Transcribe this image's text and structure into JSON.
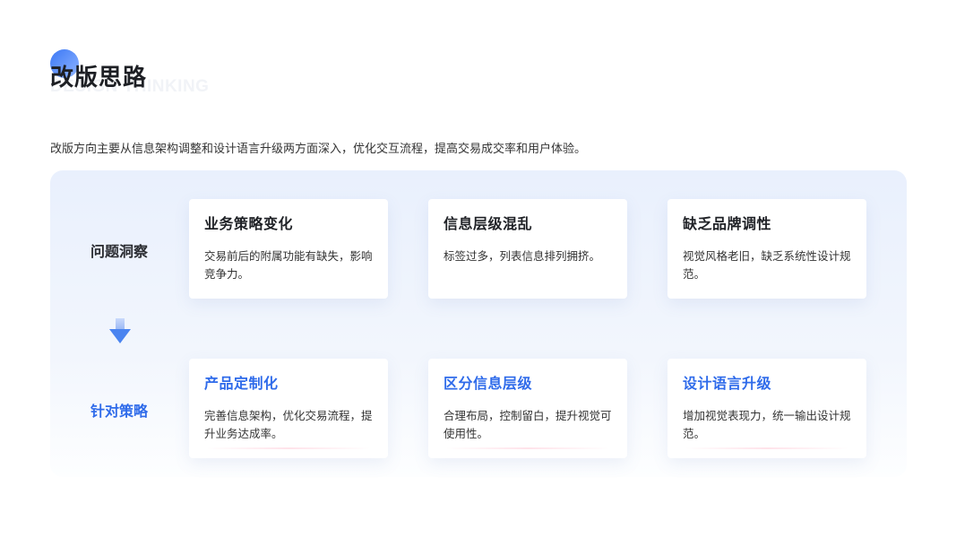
{
  "header": {
    "title": "改版思路",
    "title_en": "DESIGN THINKING",
    "subtitle": "改版方向主要从信息架构调整和设计语言升级两方面深入，优化交互流程，提高交易成交率和用户体验。"
  },
  "rows": {
    "problems_label": "问题洞察",
    "strategies_label": "针对策略"
  },
  "problems": [
    {
      "title": "业务策略变化",
      "desc": "交易前后的附属功能有缺失，影响竞争力。"
    },
    {
      "title": "信息层级混乱",
      "desc": "标签过多，列表信息排列拥挤。"
    },
    {
      "title": "缺乏品牌调性",
      "desc": "视觉风格老旧，缺乏系统性设计规范。"
    }
  ],
  "strategies": [
    {
      "title": "产品定制化",
      "desc": "完善信息架构，优化交易流程，提升业务达成率。"
    },
    {
      "title": "区分信息层级",
      "desc": "合理布局，控制留白，提升视觉可使用性。"
    },
    {
      "title": "设计语言升级",
      "desc": "增加视觉表现力，统一输出设计规范。"
    }
  ],
  "colors": {
    "accent": "#2f6bea",
    "panel_bg": "#e9f0fd",
    "dark_text": "#1f2126"
  },
  "icons": {
    "title_marker": "gradient-circle",
    "flow_arrow": "arrow-down-icon"
  }
}
